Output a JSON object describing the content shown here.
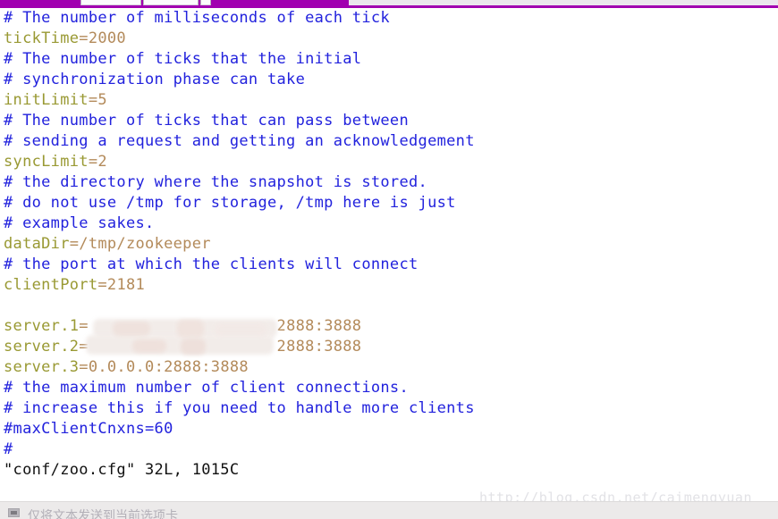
{
  "window": {
    "title": "conf/zoo.cfg",
    "accent_color": "#a100b0",
    "background_color": "#ffffff"
  },
  "top_toolbar": {
    "purple_bar_label": "",
    "chrome_box_a_label": "",
    "chrome_box_b_label": "",
    "chrome_box_c_label": "",
    "light_panel_label": ""
  },
  "editor": {
    "colors": {
      "comment": "#2222dd",
      "key": "#999933",
      "value": "#b38a5a",
      "plain": "#111111"
    },
    "lines": [
      {
        "segments": [
          {
            "text": "# The number of milliseconds of each tick",
            "cls": "c-comment"
          }
        ]
      },
      {
        "segments": [
          {
            "text": "tickTime",
            "cls": "c-key"
          },
          {
            "text": "=",
            "cls": "c-punct"
          },
          {
            "text": "2000",
            "cls": "c-val"
          }
        ]
      },
      {
        "segments": [
          {
            "text": "# The number of ticks that the initial",
            "cls": "c-comment"
          }
        ]
      },
      {
        "segments": [
          {
            "text": "# synchronization phase can take",
            "cls": "c-comment"
          }
        ]
      },
      {
        "segments": [
          {
            "text": "initLimit",
            "cls": "c-key"
          },
          {
            "text": "=",
            "cls": "c-punct"
          },
          {
            "text": "5",
            "cls": "c-val"
          }
        ]
      },
      {
        "segments": [
          {
            "text": "# The number of ticks that can pass between",
            "cls": "c-comment"
          }
        ]
      },
      {
        "segments": [
          {
            "text": "# sending a request and getting an acknowledgement",
            "cls": "c-comment"
          }
        ]
      },
      {
        "segments": [
          {
            "text": "syncLimit",
            "cls": "c-key"
          },
          {
            "text": "=",
            "cls": "c-punct"
          },
          {
            "text": "2",
            "cls": "c-val"
          }
        ]
      },
      {
        "segments": [
          {
            "text": "# the directory where the snapshot is stored.",
            "cls": "c-comment"
          }
        ]
      },
      {
        "segments": [
          {
            "text": "# do not use /tmp for storage, /tmp here is just",
            "cls": "c-comment"
          }
        ]
      },
      {
        "segments": [
          {
            "text": "# example sakes.",
            "cls": "c-comment"
          }
        ]
      },
      {
        "segments": [
          {
            "text": "dataDir",
            "cls": "c-key"
          },
          {
            "text": "=",
            "cls": "c-punct"
          },
          {
            "text": "/tmp/zookeeper",
            "cls": "c-val"
          }
        ]
      },
      {
        "segments": [
          {
            "text": "# the port at which the clients will connect",
            "cls": "c-comment"
          }
        ]
      },
      {
        "segments": [
          {
            "text": "clientPort",
            "cls": "c-key"
          },
          {
            "text": "=",
            "cls": "c-punct"
          },
          {
            "text": "2181",
            "cls": "c-val"
          }
        ]
      },
      {
        "segments": [
          {
            "text": " ",
            "cls": "c-blank"
          }
        ]
      },
      {
        "segments": [
          {
            "text": "server.1",
            "cls": "c-key"
          },
          {
            "text": "=",
            "cls": "c-punct"
          },
          {
            "text": "                    ",
            "cls": "c-val"
          },
          {
            "text": "2888:3888",
            "cls": "c-val"
          }
        ]
      },
      {
        "segments": [
          {
            "text": "server.2",
            "cls": "c-key"
          },
          {
            "text": "=",
            "cls": "c-punct"
          },
          {
            "text": "                    ",
            "cls": "c-val"
          },
          {
            "text": "2888:3888",
            "cls": "c-val"
          }
        ]
      },
      {
        "segments": [
          {
            "text": "server.3",
            "cls": "c-key"
          },
          {
            "text": "=",
            "cls": "c-punct"
          },
          {
            "text": "0.0.0.0:2888:3888",
            "cls": "c-val"
          }
        ]
      },
      {
        "segments": [
          {
            "text": "# the maximum number of client connections.",
            "cls": "c-comment"
          }
        ]
      },
      {
        "segments": [
          {
            "text": "# increase this if you need to handle more clients",
            "cls": "c-comment"
          }
        ]
      },
      {
        "segments": [
          {
            "text": "#maxClientCnxns=60",
            "cls": "c-comment"
          }
        ]
      },
      {
        "segments": [
          {
            "text": "#",
            "cls": "c-comment"
          }
        ]
      },
      {
        "segments": [
          {
            "text": "\"conf/zoo.cfg\" 32L, 1015C",
            "cls": "c-plain"
          }
        ]
      }
    ],
    "status_line": "\"conf/zoo.cfg\" 32L, 1015C",
    "redacted_note": "server.1 and server.2 IP addresses are blurred out"
  },
  "watermark": {
    "text": "http://blog.csdn.net/caimengyuan"
  },
  "bottom_bar": {
    "checkbox_icon": "checkbox-checked-icon",
    "label": "仅将文本发送到当前选项卡"
  }
}
